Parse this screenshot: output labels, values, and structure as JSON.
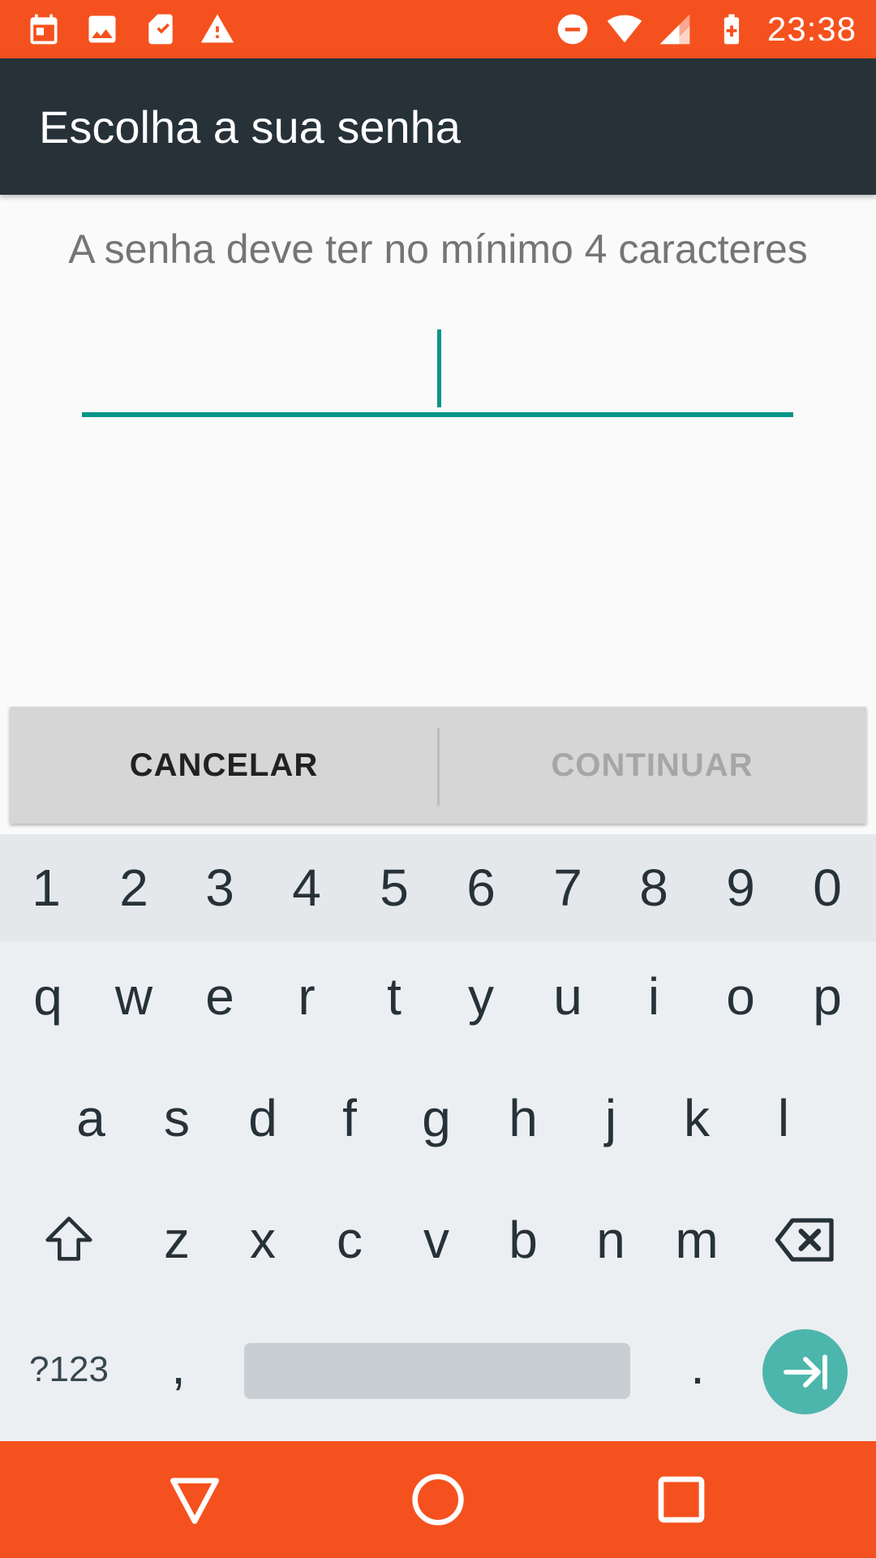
{
  "status_bar": {
    "time": "23:38",
    "left_icons": [
      "calendar-icon",
      "image-icon",
      "sd-card-icon",
      "warning-icon"
    ],
    "right_icons": [
      "do-not-disturb-icon",
      "wifi-icon",
      "cell-signal-icon",
      "battery-charging-icon"
    ],
    "color": "#f5511e"
  },
  "toolbar": {
    "title": "Escolha a sua senha",
    "color": "#263238"
  },
  "content": {
    "hint": "A senha deve ter no mínimo 4 caracteres",
    "password_value": "",
    "accent_color": "#009688"
  },
  "buttons": {
    "cancel_label": "CANCELAR",
    "continue_label": "CONTINUAR"
  },
  "keyboard": {
    "number_row": [
      "1",
      "2",
      "3",
      "4",
      "5",
      "6",
      "7",
      "8",
      "9",
      "0"
    ],
    "row1": [
      "q",
      "w",
      "e",
      "r",
      "t",
      "y",
      "u",
      "i",
      "o",
      "p"
    ],
    "row2": [
      "a",
      "s",
      "d",
      "f",
      "g",
      "h",
      "j",
      "k",
      "l"
    ],
    "row3": [
      "z",
      "x",
      "c",
      "v",
      "b",
      "n",
      "m"
    ],
    "symbols_label": "?123",
    "comma_label": ",",
    "period_label": ".",
    "enter_color": "#4db6ac"
  },
  "nav_bar": {
    "buttons": [
      "back-icon",
      "home-icon",
      "recents-icon"
    ],
    "color": "#f5511e"
  }
}
